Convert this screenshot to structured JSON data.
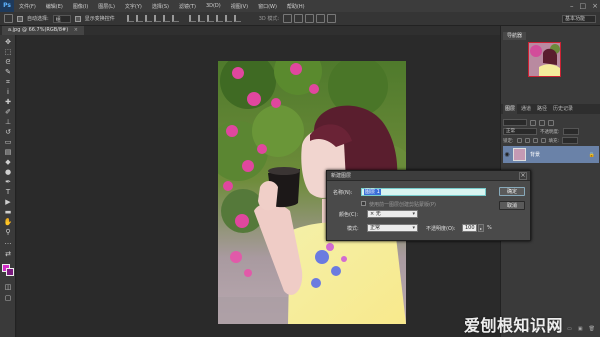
{
  "app": {
    "logo": "Ps"
  },
  "menu": [
    "文件(F)",
    "编辑(E)",
    "图像(I)",
    "图层(L)",
    "文字(Y)",
    "选择(S)",
    "滤镜(T)",
    "3D(D)",
    "视图(V)",
    "窗口(W)",
    "帮助(H)"
  ],
  "window_controls": [
    "–",
    "□",
    "×"
  ],
  "options": {
    "auto_select_label": "自动选择:",
    "auto_select_value": "组",
    "show_transform_label": "显示变换控件",
    "mode_3d_label": "3D 模式:",
    "workspace": "基本功能"
  },
  "doc_tab": {
    "label": "a.jpg @ 66.7%(RGB/8#)",
    "close": "×"
  },
  "navigator": {
    "title": "导航器"
  },
  "layers": {
    "tabs": [
      "图层",
      "通道",
      "路径",
      "历史记录"
    ],
    "blend_mode": "正常",
    "opacity_label": "不透明度:",
    "lock_label": "锁定:",
    "fill_label": "填充:",
    "layer_name": "背景",
    "lock_icon": "🔒"
  },
  "dialog": {
    "title": "新建图层",
    "name_label": "名称(N):",
    "name_value": "图层 1",
    "clip_label": "使用前一图层创建剪贴蒙版(P)",
    "color_label": "颜色(C):",
    "color_value": "× 无",
    "mode_label": "模式:",
    "mode_value": "正常",
    "opacity_label": "不透明度(O):",
    "opacity_value": "100",
    "opacity_unit": "%",
    "ok_label": "确定",
    "cancel_label": "取消",
    "close_glyph": "×"
  },
  "watermark": {
    "main": "爱刨根知识网",
    "sub": ""
  }
}
